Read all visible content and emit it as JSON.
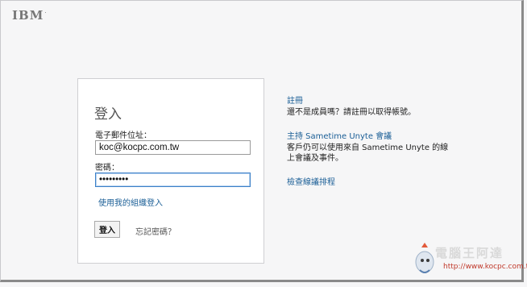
{
  "brand": {
    "logo": "IBM",
    "tm": "."
  },
  "login": {
    "title": "登入",
    "email_label": "電子郵件位址：",
    "email_value": "koc@kocpc.com.tw",
    "password_label": "密碼：",
    "password_value": "•••••••••",
    "org_link": "使用我的組織登入",
    "submit": "登入",
    "forgot": "忘記密碼？"
  },
  "side": {
    "register_link": "註冊",
    "register_desc": "還不是成員嗎？請註冊以取得帳號。",
    "host_link": "主持 Sametime Unyte 會議",
    "host_desc_1": "客戶仍可以使用來自 Sametime Unyte 的線",
    "host_desc_2": "上會議及事件。",
    "schedule_link": "檢查線議排程"
  },
  "watermark": {
    "text": "電腦王阿達",
    "url": "http://www.kocpc.com.tw"
  },
  "colors": {
    "link": "#1a5e96",
    "focus": "#3c80c8",
    "background": "#f6f6f7"
  }
}
